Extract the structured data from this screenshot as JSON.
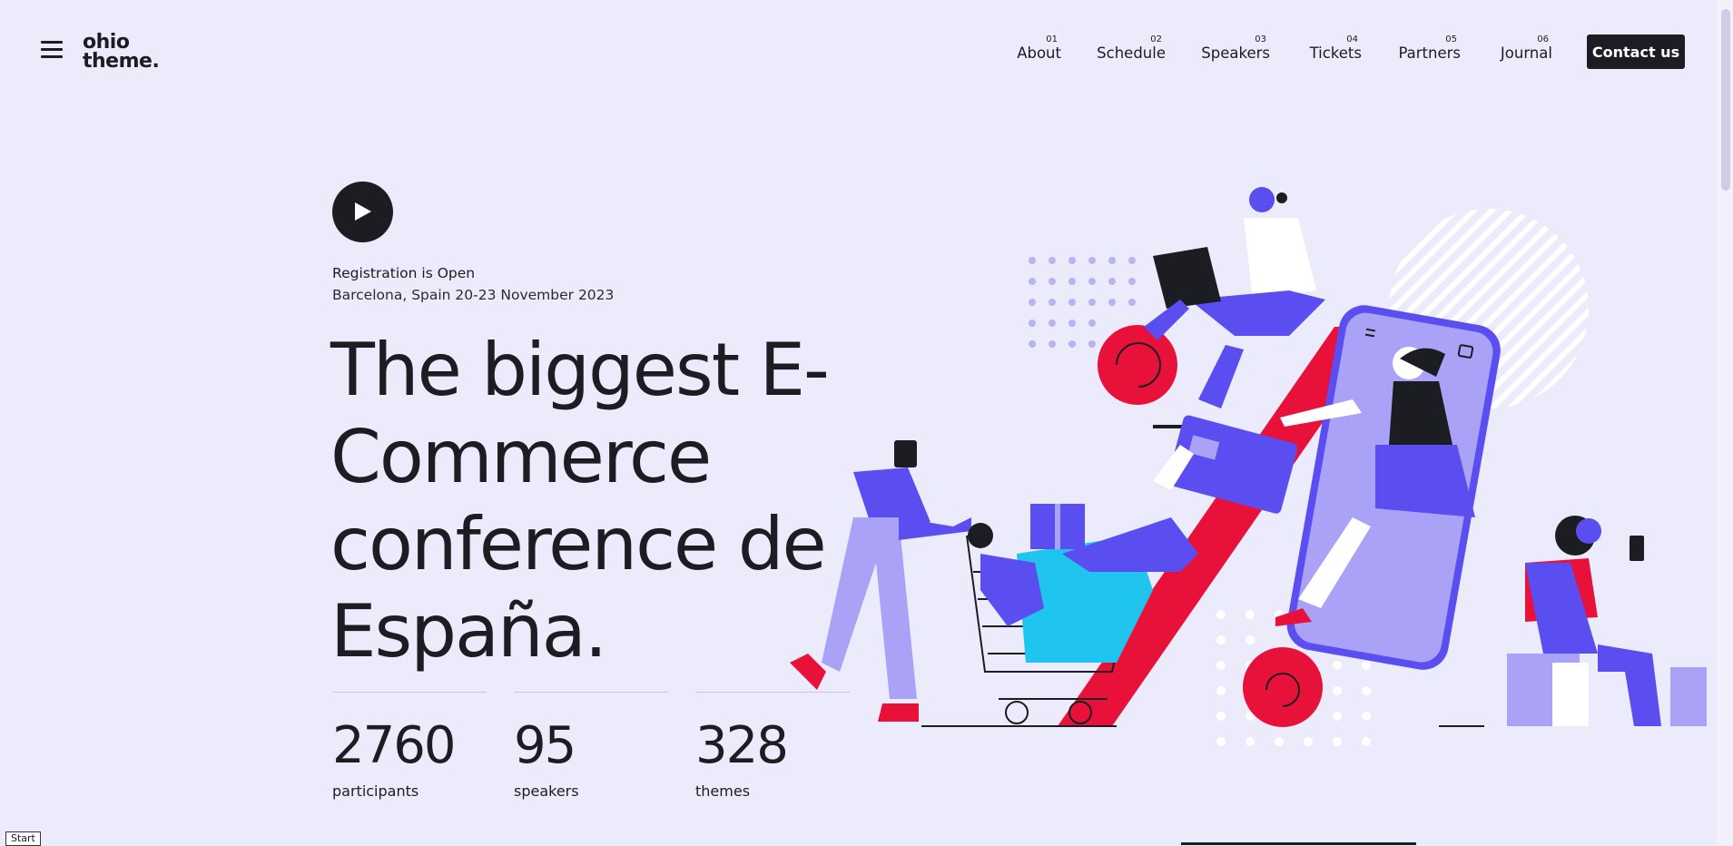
{
  "header": {
    "logo_line1": "ohio",
    "logo_line2": "theme.",
    "nav": [
      {
        "num": "01",
        "label": "About"
      },
      {
        "num": "02",
        "label": "Schedule"
      },
      {
        "num": "03",
        "label": "Speakers"
      },
      {
        "num": "04",
        "label": "Tickets"
      },
      {
        "num": "05",
        "label": "Partners"
      },
      {
        "num": "06",
        "label": "Journal"
      }
    ],
    "contact_label": "Contact us"
  },
  "hero": {
    "registration": "Registration is Open",
    "location": "Barcelona, Spain 20-23 November 2023",
    "headline_line1": "The biggest E-",
    "headline_line2": "Commerce",
    "headline_line3": "conference de",
    "headline_line4": "España.",
    "stats": [
      {
        "value": "2760",
        "label": "participants"
      },
      {
        "value": "95",
        "label": "speakers"
      },
      {
        "value": "328",
        "label": "themes"
      }
    ]
  },
  "footer": {
    "start_label": "Start"
  },
  "colors": {
    "background": "#ecebfb",
    "text": "#1c1d22",
    "accent_red": "#e8113a",
    "accent_purple": "#5b4ef0",
    "accent_lavender": "#a9a2f7",
    "accent_cyan": "#1fc4ef"
  },
  "icons": {
    "menu": "hamburger-menu-icon",
    "play": "play-icon"
  }
}
